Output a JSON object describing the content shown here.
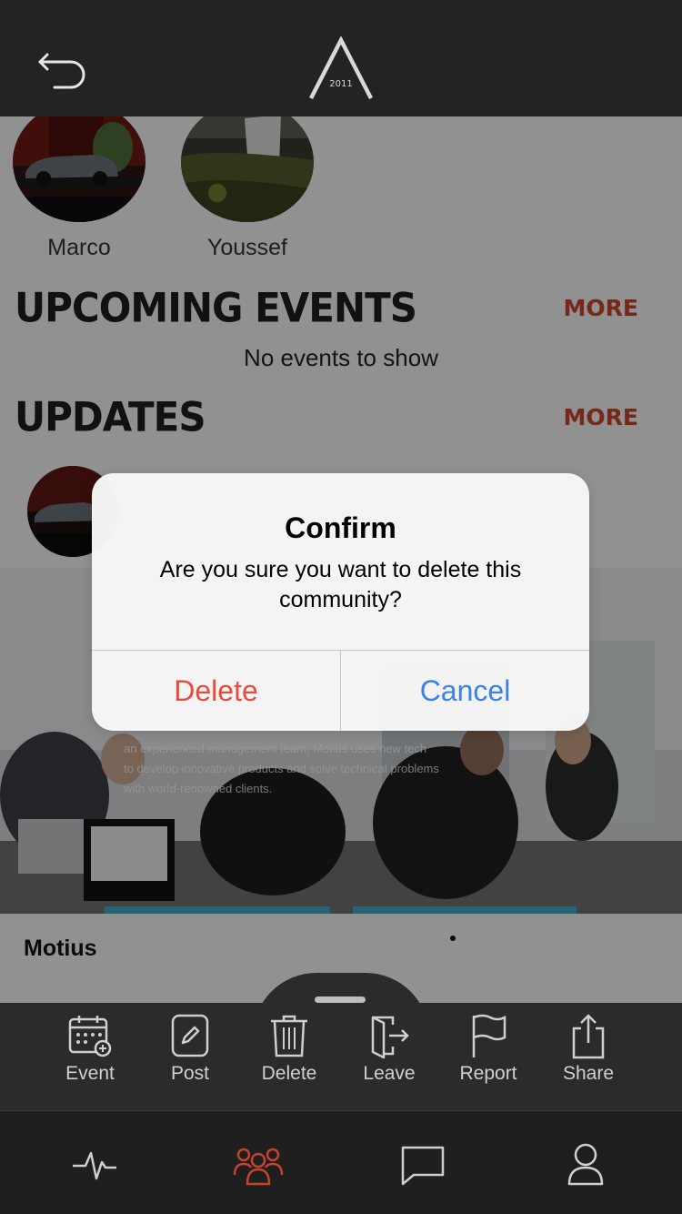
{
  "header": {
    "logo_text": "2011"
  },
  "members": [
    {
      "name": "Marco"
    },
    {
      "name": "Youssef"
    }
  ],
  "sections": {
    "upcoming_events": {
      "title": "UPCOMING EVENTS",
      "more": "MORE",
      "empty": "No events to show"
    },
    "updates": {
      "title": "UPDATES",
      "more": "MORE"
    }
  },
  "banner": {
    "lines": [
      "an experienced management team, Motius uses new tech",
      "to develop innovative products and solve technical problems",
      "with world-renowned clients."
    ]
  },
  "card": {
    "title": "Motius"
  },
  "actions": [
    {
      "label": "Event",
      "icon": "calendar-plus-icon"
    },
    {
      "label": "Post",
      "icon": "pencil-icon"
    },
    {
      "label": "Delete",
      "icon": "trash-icon"
    },
    {
      "label": "Leave",
      "icon": "exit-door-icon"
    },
    {
      "label": "Report",
      "icon": "flag-icon"
    },
    {
      "label": "Share",
      "icon": "share-icon"
    }
  ],
  "nav": [
    {
      "icon": "activity-icon"
    },
    {
      "icon": "community-icon"
    },
    {
      "icon": "chat-icon"
    },
    {
      "icon": "profile-icon"
    }
  ],
  "dialog": {
    "title": "Confirm",
    "message": "Are you sure you want to delete this community?",
    "delete_label": "Delete",
    "cancel_label": "Cancel"
  },
  "colors": {
    "accent": "#c5432d",
    "nav_active": "#c5432d",
    "dialog_delete": "#e74c3c",
    "dialog_cancel": "#3a82e4"
  }
}
